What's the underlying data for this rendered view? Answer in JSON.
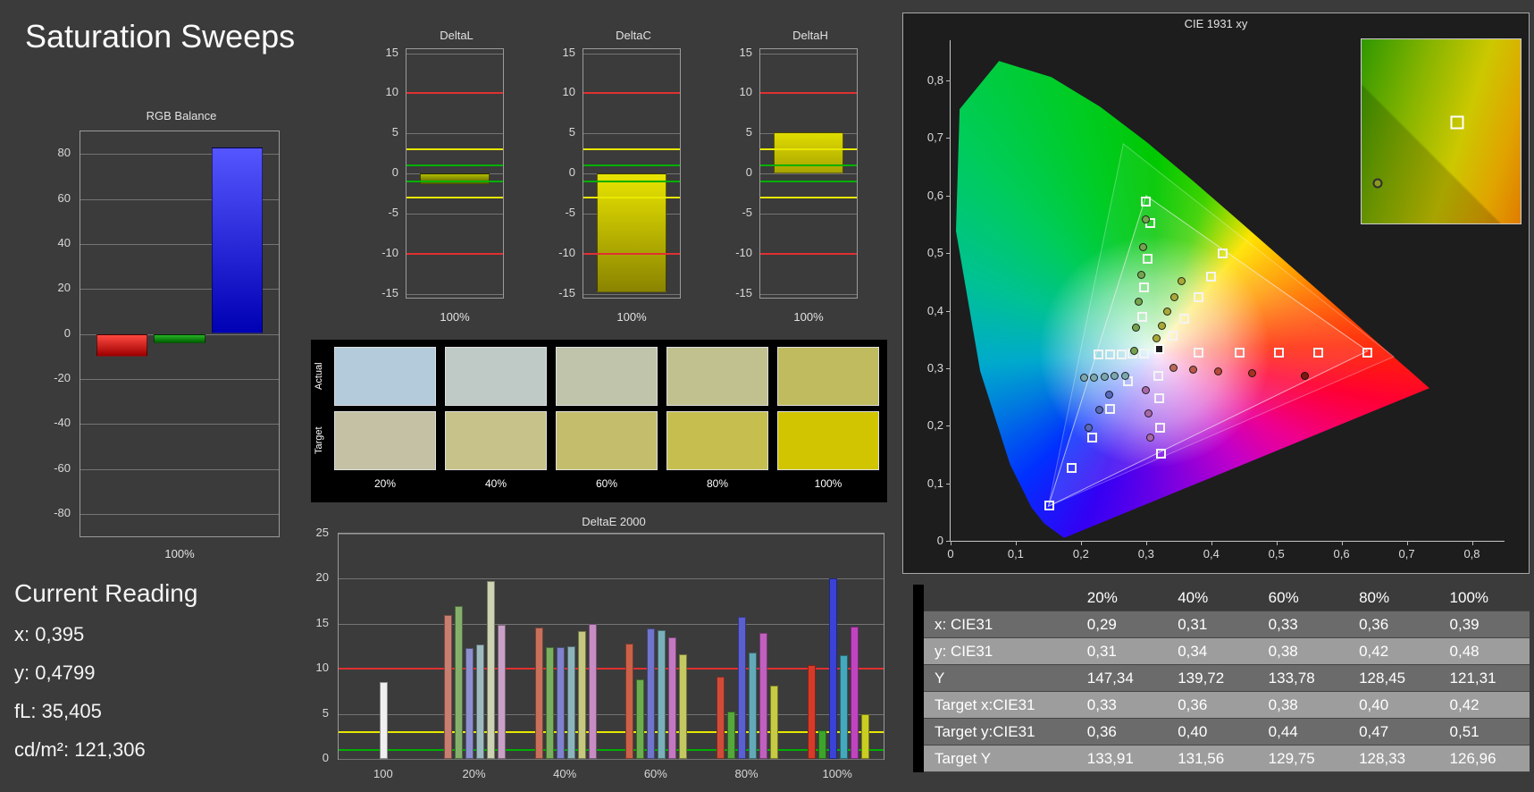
{
  "title": "Saturation Sweeps",
  "current_reading": {
    "heading": "Current Reading",
    "items": [
      "x: 0,395",
      "y: 0,4799",
      "fL: 35,405",
      "cd/m²: 121,306"
    ]
  },
  "swatches": {
    "row_labels": [
      "Actual",
      "Target"
    ],
    "col_labels": [
      "20%",
      "40%",
      "60%",
      "80%",
      "100%"
    ],
    "actual": [
      "#b4cbdc",
      "#bfcac7",
      "#bfc4ab",
      "#c0c18f",
      "#c0bb5f"
    ],
    "target": [
      "#c4c1a4",
      "#c7c28a",
      "#c4be6c",
      "#c6bf4f",
      "#d0c500"
    ]
  },
  "table": {
    "headers": [
      "20%",
      "40%",
      "60%",
      "80%",
      "100%"
    ],
    "rows": [
      {
        "label": "x: CIE31",
        "values": [
          "0,29",
          "0,31",
          "0,33",
          "0,36",
          "0,39"
        ]
      },
      {
        "label": "y: CIE31",
        "values": [
          "0,31",
          "0,34",
          "0,38",
          "0,42",
          "0,48"
        ]
      },
      {
        "label": "Y",
        "values": [
          "147,34",
          "139,72",
          "133,78",
          "128,45",
          "121,31"
        ]
      },
      {
        "label": "Target x:CIE31",
        "values": [
          "0,33",
          "0,36",
          "0,38",
          "0,40",
          "0,42"
        ]
      },
      {
        "label": "Target y:CIE31",
        "values": [
          "0,36",
          "0,40",
          "0,44",
          "0,47",
          "0,51"
        ]
      },
      {
        "label": "Target Y",
        "values": [
          "133,91",
          "131,56",
          "129,75",
          "128,33",
          "126,96"
        ]
      }
    ]
  },
  "chart_data": {
    "rgb_balance": {
      "type": "bar",
      "title": "RGB Balance",
      "categories": [
        "Red",
        "Green",
        "Blue"
      ],
      "values": [
        -10,
        -4,
        83
      ],
      "colors": [
        [
          "#ff4840",
          "#9c0000"
        ],
        [
          "#28b428",
          "#006000"
        ],
        [
          "#5656ff",
          "#0000b4"
        ]
      ],
      "ylim": [
        -90,
        90
      ],
      "yticks": [
        80,
        60,
        40,
        20,
        0,
        -20,
        -40,
        -60,
        -80
      ],
      "xlabel": "100%"
    },
    "delta_charts": [
      {
        "type": "bar",
        "title": "DeltaL",
        "value": -1.3,
        "fill": [
          "#b2bc00",
          "#5a6400"
        ],
        "ylim": [
          -15.5,
          15.5
        ],
        "yticks": [
          15,
          10,
          5,
          0,
          -5,
          -10,
          -15
        ],
        "ref_lines": [
          {
            "v": 10,
            "c": "#e03030"
          },
          {
            "v": -10,
            "c": "#e03030"
          },
          {
            "v": 3,
            "c": "#e8e800"
          },
          {
            "v": -3,
            "c": "#e8e800"
          },
          {
            "v": 1,
            "c": "#00b000"
          },
          {
            "v": -1,
            "c": "#00b000"
          }
        ],
        "xlabel": "100%"
      },
      {
        "type": "bar",
        "title": "DeltaC",
        "value": -14.8,
        "fill": [
          "#e8e400",
          "#8a8400"
        ],
        "ylim": [
          -15.5,
          15.5
        ],
        "yticks": [
          15,
          10,
          5,
          0,
          -5,
          -10,
          -15
        ],
        "ref_lines": [
          {
            "v": 10,
            "c": "#e03030"
          },
          {
            "v": -10,
            "c": "#e03030"
          },
          {
            "v": 3,
            "c": "#e8e800"
          },
          {
            "v": -3,
            "c": "#e8e800"
          },
          {
            "v": 1,
            "c": "#00b000"
          },
          {
            "v": -1,
            "c": "#00b000"
          }
        ],
        "xlabel": "100%"
      },
      {
        "type": "bar",
        "title": "DeltaH",
        "value": 5.1,
        "fill": [
          "#e0dc00",
          "#a8a400"
        ],
        "ylim": [
          -15.5,
          15.5
        ],
        "yticks": [
          15,
          10,
          5,
          0,
          -5,
          -10,
          -15
        ],
        "ref_lines": [
          {
            "v": 10,
            "c": "#e03030"
          },
          {
            "v": -10,
            "c": "#e03030"
          },
          {
            "v": 3,
            "c": "#e8e800"
          },
          {
            "v": -3,
            "c": "#e8e800"
          },
          {
            "v": 1,
            "c": "#00b000"
          },
          {
            "v": -1,
            "c": "#00b000"
          }
        ],
        "xlabel": "100%"
      }
    ],
    "deltae": {
      "type": "bar",
      "title": "DeltaE 2000",
      "ylim": [
        0,
        25
      ],
      "yticks": [
        25,
        20,
        15,
        10,
        5,
        0
      ],
      "ref_lines": [
        {
          "v": 10,
          "c": "#e03030"
        },
        {
          "v": 3,
          "c": "#e8e800"
        },
        {
          "v": 1,
          "c": "#00b000"
        }
      ],
      "groups": [
        {
          "label": "100",
          "bars": [
            {
              "v": 8.5,
              "c": "#f0f0f0"
            }
          ]
        },
        {
          "label": "20%",
          "bars": [
            {
              "v": 16.0,
              "c": "#c87f72"
            },
            {
              "v": 17.0,
              "c": "#85b06c"
            },
            {
              "v": 12.3,
              "c": "#8d8fce"
            },
            {
              "v": 12.7,
              "c": "#9dbac0"
            },
            {
              "v": 19.7,
              "c": "#cdd2b2"
            },
            {
              "v": 14.9,
              "c": "#c9a0c6"
            }
          ]
        },
        {
          "label": "40%",
          "bars": [
            {
              "v": 14.6,
              "c": "#c9705c"
            },
            {
              "v": 12.4,
              "c": "#79af5e"
            },
            {
              "v": 12.4,
              "c": "#7f82cc"
            },
            {
              "v": 12.5,
              "c": "#8cb4bd"
            },
            {
              "v": 14.2,
              "c": "#c5c87e"
            },
            {
              "v": 15.0,
              "c": "#c78cc4"
            }
          ]
        },
        {
          "label": "60%",
          "bars": [
            {
              "v": 12.8,
              "c": "#cb6148"
            },
            {
              "v": 8.8,
              "c": "#6cae4f"
            },
            {
              "v": 14.5,
              "c": "#6f74cc"
            },
            {
              "v": 14.3,
              "c": "#79b0ba"
            },
            {
              "v": 13.5,
              "c": "#c478c2"
            },
            {
              "v": 11.6,
              "c": "#c4c862"
            }
          ]
        },
        {
          "label": "80%",
          "bars": [
            {
              "v": 9.1,
              "c": "#d04c38"
            },
            {
              "v": 5.3,
              "c": "#55a83c"
            },
            {
              "v": 15.8,
              "c": "#5a60d0"
            },
            {
              "v": 11.8,
              "c": "#62aab8"
            },
            {
              "v": 14.0,
              "c": "#c160bf"
            },
            {
              "v": 8.1,
              "c": "#c6ca44"
            }
          ]
        },
        {
          "label": "100%",
          "bars": [
            {
              "v": 10.4,
              "c": "#d63a28"
            },
            {
              "v": 3.2,
              "c": "#3da32c"
            },
            {
              "v": 20.0,
              "c": "#3a42d8"
            },
            {
              "v": 11.5,
              "c": "#45a8bc"
            },
            {
              "v": 14.7,
              "c": "#c044c0"
            },
            {
              "v": 5.0,
              "c": "#cace22"
            }
          ]
        }
      ]
    },
    "cie": {
      "type": "scatter",
      "title": "CIE 1931 xy",
      "xlim": [
        0,
        0.85
      ],
      "ylim": [
        0,
        0.87
      ],
      "ticks": [
        {
          "v": 0,
          "l": "0"
        },
        {
          "v": 0.1,
          "l": "0,1"
        },
        {
          "v": 0.2,
          "l": "0,2"
        },
        {
          "v": 0.3,
          "l": "0,3"
        },
        {
          "v": 0.4,
          "l": "0,4"
        },
        {
          "v": 0.5,
          "l": "0,5"
        },
        {
          "v": 0.6,
          "l": "0,6"
        },
        {
          "v": 0.7,
          "l": "0,7"
        },
        {
          "v": 0.8,
          "l": "0,8"
        }
      ],
      "white_point": [
        0.313,
        0.329
      ],
      "locus": [
        [
          0.1741,
          0.005
        ],
        [
          0.144,
          0.0297
        ],
        [
          0.1241,
          0.0578
        ],
        [
          0.0913,
          0.1327
        ],
        [
          0.0454,
          0.295
        ],
        [
          0.0082,
          0.5384
        ],
        [
          0.0139,
          0.7502
        ],
        [
          0.0743,
          0.8338
        ],
        [
          0.1547,
          0.8059
        ],
        [
          0.2296,
          0.7543
        ],
        [
          0.3016,
          0.6923
        ],
        [
          0.3731,
          0.6245
        ],
        [
          0.4441,
          0.5547
        ],
        [
          0.5125,
          0.4866
        ],
        [
          0.5752,
          0.4242
        ],
        [
          0.627,
          0.3725
        ],
        [
          0.6658,
          0.334
        ],
        [
          0.6915,
          0.3083
        ],
        [
          0.7079,
          0.292
        ],
        [
          0.7347,
          0.2653
        ]
      ],
      "gamut_triangles": [
        [
          [
            0.64,
            0.33
          ],
          [
            0.3,
            0.6
          ],
          [
            0.15,
            0.06
          ]
        ],
        [
          [
            0.68,
            0.32
          ],
          [
            0.265,
            0.69
          ],
          [
            0.15,
            0.06
          ]
        ]
      ],
      "targets": [
        [
          0.299,
          0.59
        ],
        [
          0.306,
          0.553
        ],
        [
          0.302,
          0.49
        ],
        [
          0.297,
          0.44
        ],
        [
          0.294,
          0.39
        ],
        [
          0.418,
          0.499
        ],
        [
          0.399,
          0.459
        ],
        [
          0.381,
          0.424
        ],
        [
          0.358,
          0.386
        ],
        [
          0.34,
          0.357
        ],
        [
          0.38,
          0.327
        ],
        [
          0.443,
          0.327
        ],
        [
          0.504,
          0.327
        ],
        [
          0.564,
          0.327
        ],
        [
          0.64,
          0.327
        ],
        [
          0.297,
          0.325
        ],
        [
          0.279,
          0.325
        ],
        [
          0.262,
          0.324
        ],
        [
          0.244,
          0.324
        ],
        [
          0.227,
          0.324
        ],
        [
          0.318,
          0.287
        ],
        [
          0.32,
          0.248
        ],
        [
          0.321,
          0.197
        ],
        [
          0.323,
          0.152
        ],
        [
          0.272,
          0.277
        ],
        [
          0.245,
          0.229
        ],
        [
          0.217,
          0.179
        ],
        [
          0.186,
          0.127
        ],
        [
          0.151,
          0.062
        ]
      ],
      "current_target": [
        0.32,
        0.333
      ],
      "measurements": [
        {
          "x": 0.205,
          "y": 0.283,
          "c": "#7aa8ae"
        },
        {
          "x": 0.22,
          "y": 0.284,
          "c": "#7aa8ae"
        },
        {
          "x": 0.236,
          "y": 0.285,
          "c": "#7aa8ae"
        },
        {
          "x": 0.252,
          "y": 0.286,
          "c": "#7aa8ae"
        },
        {
          "x": 0.268,
          "y": 0.287,
          "c": "#7aa8ae"
        },
        {
          "x": 0.282,
          "y": 0.33,
          "c": "#76a24e"
        },
        {
          "x": 0.285,
          "y": 0.37,
          "c": "#76a24e"
        },
        {
          "x": 0.288,
          "y": 0.415,
          "c": "#76a24e"
        },
        {
          "x": 0.292,
          "y": 0.462,
          "c": "#76a24e"
        },
        {
          "x": 0.296,
          "y": 0.51,
          "c": "#76a24e"
        },
        {
          "x": 0.3,
          "y": 0.558,
          "c": "#76a24e"
        },
        {
          "x": 0.316,
          "y": 0.352,
          "c": "#a8a838"
        },
        {
          "x": 0.324,
          "y": 0.374,
          "c": "#a8a838"
        },
        {
          "x": 0.333,
          "y": 0.398,
          "c": "#a8a838"
        },
        {
          "x": 0.343,
          "y": 0.424,
          "c": "#a8a838"
        },
        {
          "x": 0.355,
          "y": 0.452,
          "c": "#a8a838"
        },
        {
          "x": 0.342,
          "y": 0.3,
          "c": "#b86858"
        },
        {
          "x": 0.372,
          "y": 0.297,
          "c": "#b85848"
        },
        {
          "x": 0.41,
          "y": 0.294,
          "c": "#b84838"
        },
        {
          "x": 0.462,
          "y": 0.291,
          "c": "#a83020"
        },
        {
          "x": 0.543,
          "y": 0.287,
          "c": "#7a1812"
        },
        {
          "x": 0.299,
          "y": 0.262,
          "c": "#a868a8"
        },
        {
          "x": 0.303,
          "y": 0.222,
          "c": "#a868a8"
        },
        {
          "x": 0.307,
          "y": 0.18,
          "c": "#a868a8"
        },
        {
          "x": 0.243,
          "y": 0.254,
          "c": "#5868b8"
        },
        {
          "x": 0.228,
          "y": 0.227,
          "c": "#5868b8"
        },
        {
          "x": 0.212,
          "y": 0.196,
          "c": "#5868b8"
        }
      ],
      "inset": {
        "square": [
          0.6,
          0.45
        ],
        "dot": [
          0.1,
          0.78
        ],
        "dot_color": "#8a9a20"
      }
    }
  }
}
